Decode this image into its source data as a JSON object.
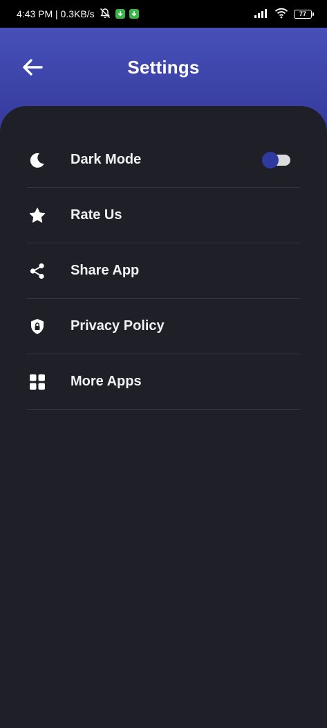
{
  "status_bar": {
    "time_speed": "4:43 PM | 0.3KB/s",
    "battery": "77"
  },
  "header": {
    "title": "Settings"
  },
  "settings": {
    "items": [
      {
        "label": "Dark Mode",
        "icon": "moon-icon",
        "toggle_on": true
      },
      {
        "label": "Rate Us",
        "icon": "star-icon"
      },
      {
        "label": "Share App",
        "icon": "share-icon"
      },
      {
        "label": "Privacy Policy",
        "icon": "shield-lock-icon"
      },
      {
        "label": "More Apps",
        "icon": "apps-grid-icon"
      }
    ]
  },
  "colors": {
    "header_top": "#4650b8",
    "header_bottom": "#34399a",
    "background": "#1e1f27",
    "toggle_knob": "#2f3aa0"
  }
}
